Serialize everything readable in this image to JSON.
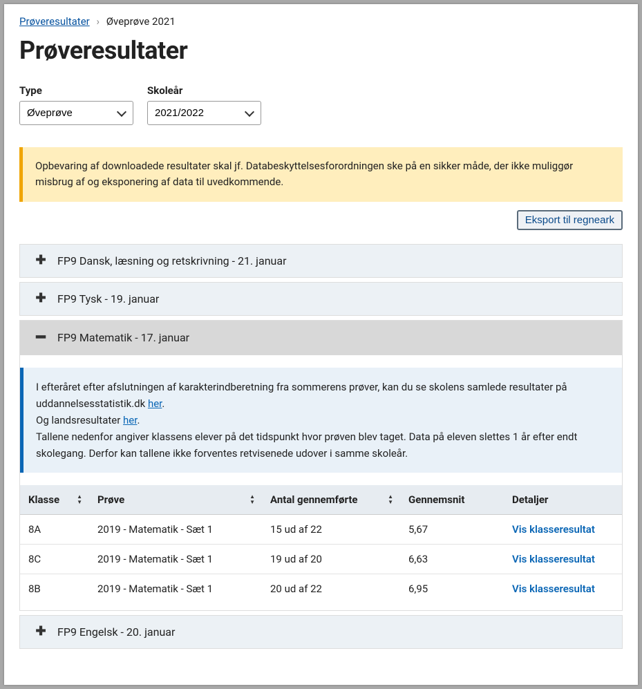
{
  "breadcrumb": {
    "root": "Prøveresultater",
    "current": "Øveprøve 2021"
  },
  "heading": "Prøveresultater",
  "filters": {
    "type": {
      "label": "Type",
      "value": "Øveprøve"
    },
    "year": {
      "label": "Skoleår",
      "value": "2021/2022"
    }
  },
  "data_warning": "Opbevaring af downloadede resultater skal jf. Databeskyttelsesforordningen ske på en sikker måde, der ikke muliggør misbrug af og eksponering af data til uvedkommende.",
  "export_label": "Eksport til regneark",
  "accordion": [
    {
      "title": "FP9 Dansk, læsning og retskrivning - 21. januar",
      "expanded": false
    },
    {
      "title": "FP9 Tysk - 19. januar",
      "expanded": false
    },
    {
      "title": "FP9 Matematik - 17. januar",
      "expanded": true
    },
    {
      "title": "FP9 Engelsk - 20. januar",
      "expanded": false
    }
  ],
  "info_box": {
    "line1_pre": "I efteråret efter afslutningen af karakterindberetning fra sommerens prøver, kan du se skolens samlede resultater på uddannelsesstatistik.dk ",
    "link1": "her",
    "line2_pre": "Og landsresultater ",
    "link2": "her",
    "line3": "Tallene nedenfor angiver klassens elever på det tidspunkt hvor prøven blev taget. Data på eleven slettes 1 år efter endt skolegang. Derfor kan tallene ikke forventes retvisenede udover i samme skoleår."
  },
  "table": {
    "headers": {
      "klasse": "Klasse",
      "prove": "Prøve",
      "antal": "Antal gennemførte",
      "gennemsnit": "Gennemsnit",
      "detaljer": "Detaljer"
    },
    "rows": [
      {
        "klasse": "8A",
        "prove": "2019 - Matematik - Sæt 1",
        "antal": "15 ud af 22",
        "gennemsnit": "5,67",
        "link": "Vis klasseresultat"
      },
      {
        "klasse": "8C",
        "prove": "2019 - Matematik - Sæt 1",
        "antal": "19 ud af 20",
        "gennemsnit": "6,63",
        "link": "Vis klasseresultat"
      },
      {
        "klasse": "8B",
        "prove": "2019 - Matematik - Sæt 1",
        "antal": "20 ud af 22",
        "gennemsnit": "6,95",
        "link": "Vis klasseresultat"
      }
    ]
  }
}
